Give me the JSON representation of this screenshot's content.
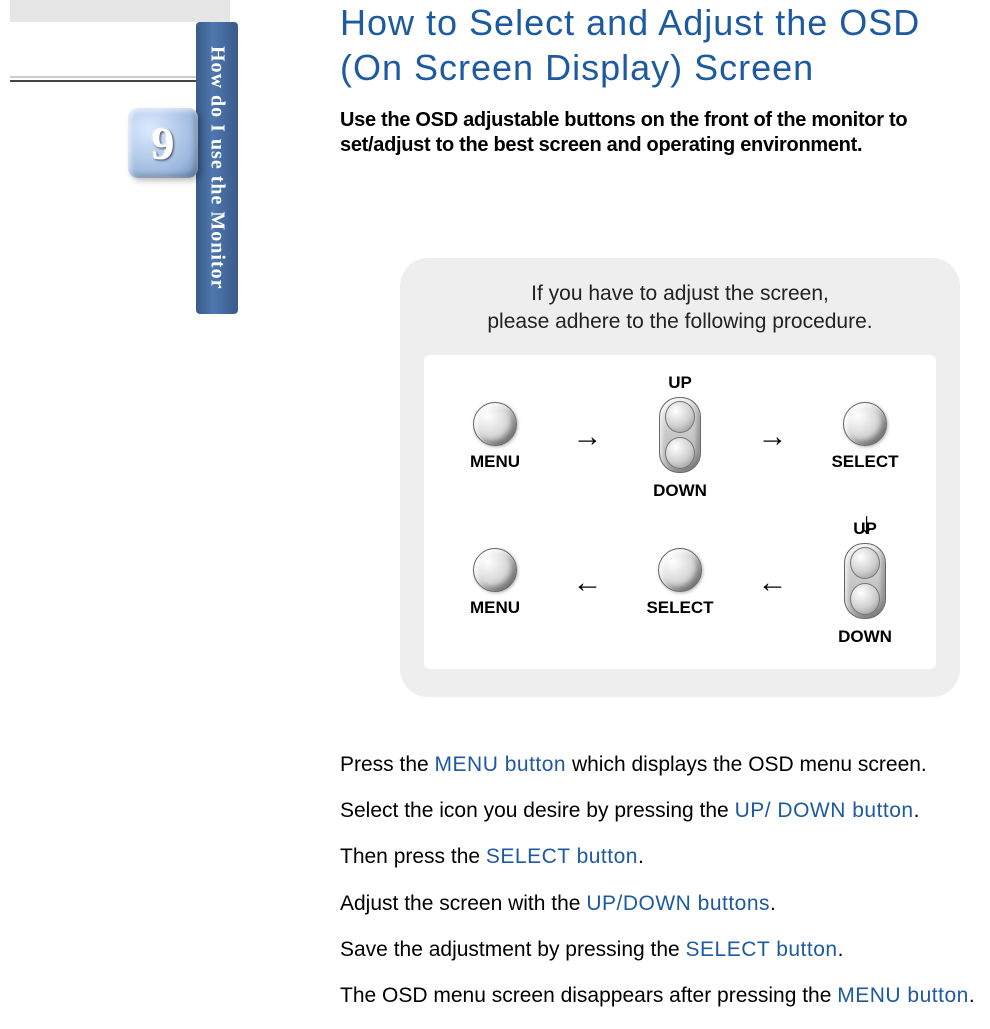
{
  "sidebar": {
    "tab_label": "How do I use the Monitor",
    "page_number": "9"
  },
  "title_line1": "How to Select and Adjust the OSD",
  "title_line2": "(On Screen Display) Screen",
  "intro": "Use the OSD adjustable buttons on the front of the monitor to set/adjust to the best screen and operating environment.",
  "panel_text_line1": "If you have to adjust the screen,",
  "panel_text_line2": "please adhere to the following procedure.",
  "labels": {
    "menu": "MENU",
    "up": "UP",
    "down": "DOWN",
    "select": "SELECT"
  },
  "steps": {
    "s1a": "Press the ",
    "s1k": "MENU button",
    "s1b": " which displays the OSD menu screen.",
    "s2a": "Select the icon you  desire by pressing  the ",
    "s2k": "UP/ DOWN button",
    "s2b": ".",
    "s3a": "Then  press the ",
    "s3k": "SELECT button",
    "s3b": ".",
    "s4a": "Adjust the screen with the ",
    "s4k": "UP/DOWN buttons",
    "s4b": ".",
    "s5a": "Save the adjustment by pressing the ",
    "s5k": "SELECT button",
    "s5b": ".",
    "s6a": "The OSD menu screen disappears after pressing the ",
    "s6k": "MENU button",
    "s6b": "."
  }
}
